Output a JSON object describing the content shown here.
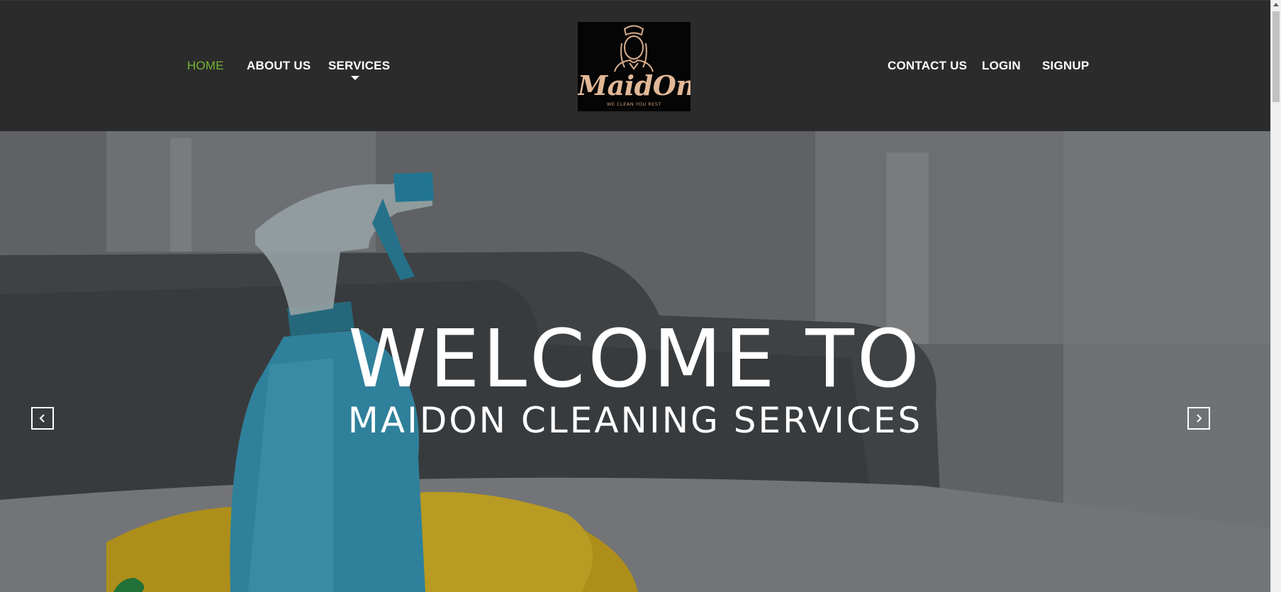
{
  "nav": {
    "left": [
      {
        "label": "HOME",
        "active": true
      },
      {
        "label": "ABOUT US"
      },
      {
        "label": "SERVICES",
        "has_dropdown": true
      }
    ],
    "right": [
      {
        "label": "CONTACT US"
      },
      {
        "label": "LOGIN"
      },
      {
        "label": "SIGNUP"
      }
    ],
    "active_color": "#77b633"
  },
  "logo": {
    "name": "MaidOn",
    "tagline": "WE CLEAN YOU REST"
  },
  "hero": {
    "title": "WELCOME TO",
    "subtitle": "MAIDON CLEANING SERVICES",
    "prev_icon": "chevron-left-icon",
    "next_icon": "chevron-right-icon"
  },
  "colors": {
    "header_bg": "#2b2b2b",
    "bottle": "#3aa0c0",
    "gloves": "#e8c21a"
  }
}
